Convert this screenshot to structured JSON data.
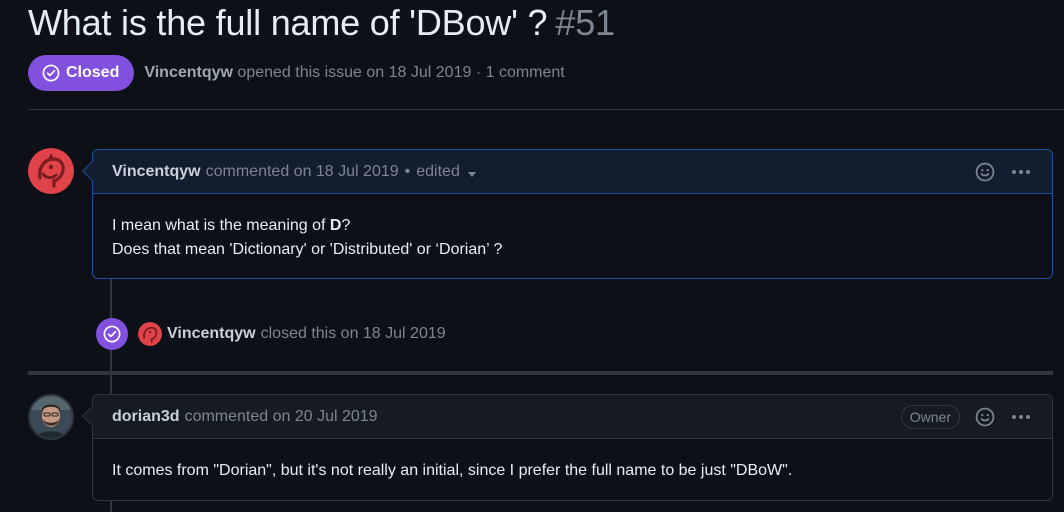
{
  "issue": {
    "title": "What is the full name of 'DBow' ?",
    "number": "#51",
    "state": "Closed",
    "author": "Vincentqyw",
    "opened_text": "opened this issue on 18 Jul 2019 · 1 comment"
  },
  "comments": [
    {
      "author": "Vincentqyw",
      "meta": "commented on 18 Jul 2019",
      "edited": "edited",
      "body_line1_pre": "I mean what is the meaning of ",
      "body_line1_bold": "D",
      "body_line1_post": "?",
      "body_line2": "Does that mean 'Dictionary' or 'Distributed' or ‘Dorian’ ?"
    },
    {
      "author": "dorian3d",
      "meta": "commented on 20 Jul 2019",
      "role_badge": "Owner",
      "body": "It comes from \"Dorian\", but it's not really an initial, since I prefer the full name to be just \"DBoW\"."
    }
  ],
  "event": {
    "actor": "Vincentqyw",
    "text": "closed this on 18 Jul 2019"
  },
  "icons": {
    "state": "check-circle-icon",
    "emoji": "smiley-icon",
    "menu": "kebab-horizontal-icon",
    "dropdown": "triangle-down-icon"
  },
  "colors": {
    "closed_purple": "#8250df",
    "background": "#0d1117",
    "border": "#30363d",
    "muted_text": "#7d8590"
  }
}
